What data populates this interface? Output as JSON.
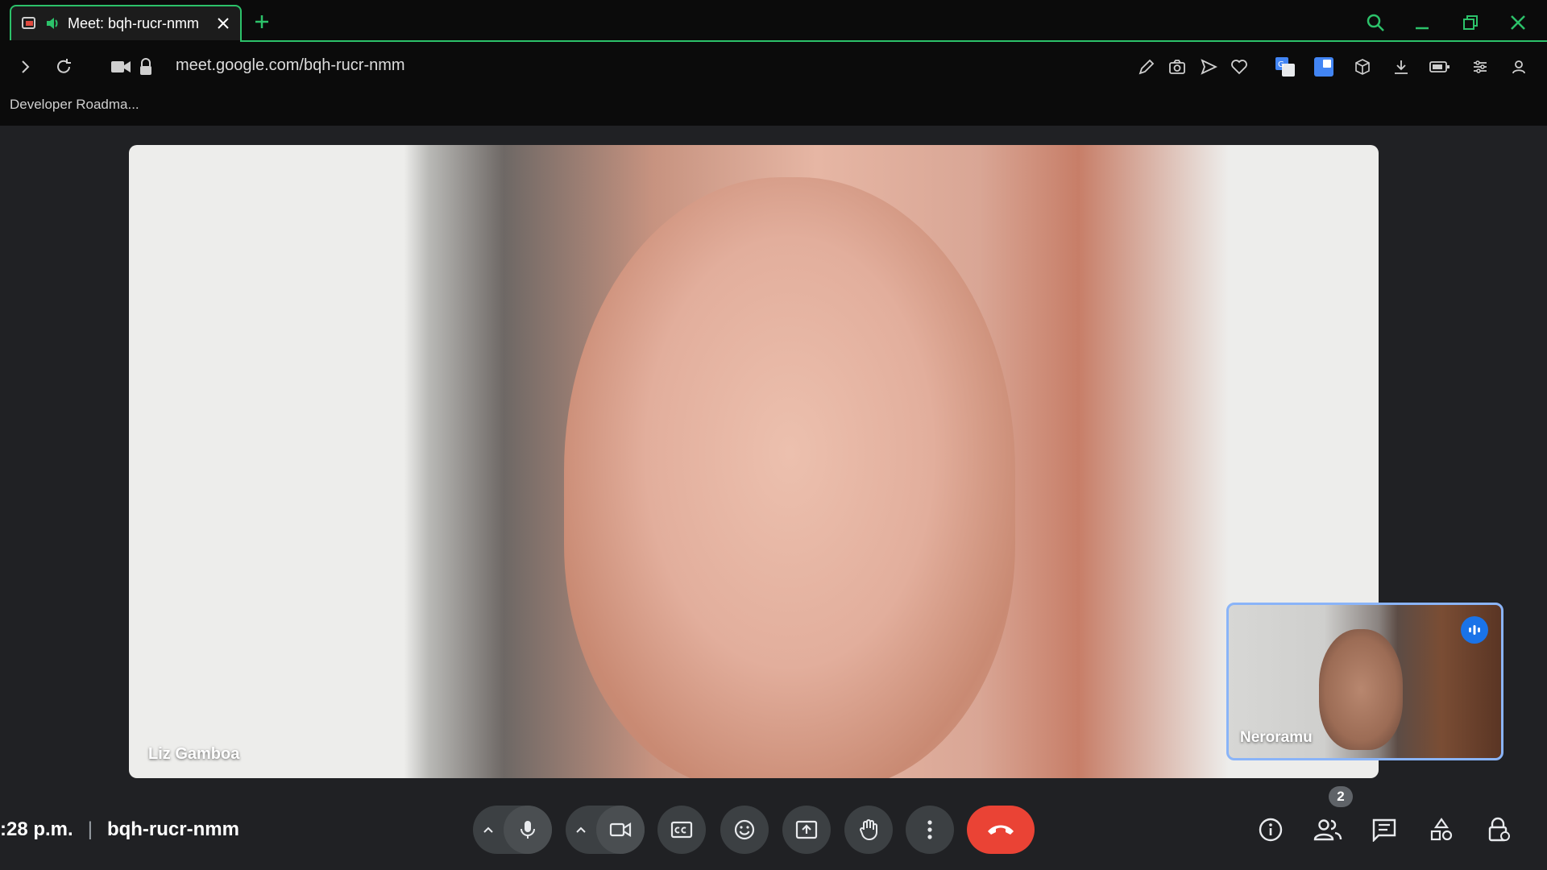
{
  "browser": {
    "tab_title": "Meet: bqh-rucr-nmm",
    "url": "meet.google.com/bqh-rucr-nmm",
    "bookmark": "Developer Roadma...",
    "accent_color": "#2cc26a"
  },
  "meet": {
    "main_participant_name": "Liz Gamboa",
    "self_participant_name": "Neroramu",
    "time": ":28 p.m.",
    "meeting_code": "bqh-rucr-nmm",
    "participant_count": "2",
    "end_call_color": "#ea4335",
    "speaking_color": "#1a73e8"
  }
}
